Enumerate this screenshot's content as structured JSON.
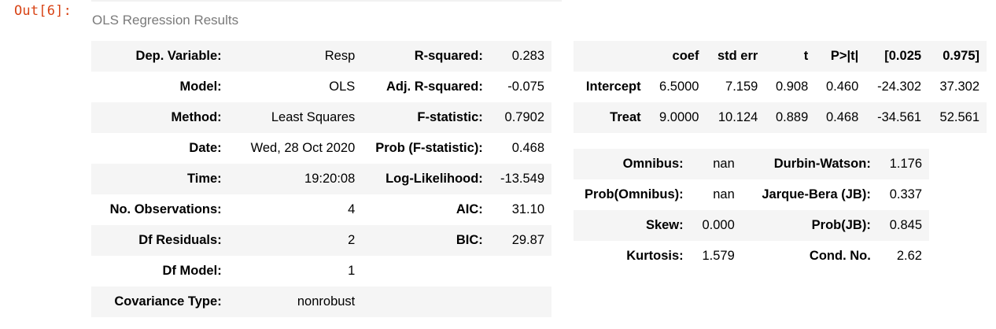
{
  "cell": {
    "prompt": "Out[6]:"
  },
  "summary": {
    "caption": "OLS Regression Results",
    "top_rows": [
      {
        "l1": "Dep. Variable:",
        "v1": "Resp",
        "l2": "R-squared:",
        "v2": "0.283"
      },
      {
        "l1": "Model:",
        "v1": "OLS",
        "l2": "Adj. R-squared:",
        "v2": "-0.075"
      },
      {
        "l1": "Method:",
        "v1": "Least Squares",
        "l2": "F-statistic:",
        "v2": "0.7902"
      },
      {
        "l1": "Date:",
        "v1": "Wed, 28 Oct 2020",
        "l2": "Prob (F-statistic):",
        "v2": "0.468"
      },
      {
        "l1": "Time:",
        "v1": "19:20:08",
        "l2": "Log-Likelihood:",
        "v2": "-13.549"
      },
      {
        "l1": "No. Observations:",
        "v1": "4",
        "l2": "AIC:",
        "v2": "31.10"
      },
      {
        "l1": "Df Residuals:",
        "v1": "2",
        "l2": "BIC:",
        "v2": "29.87"
      },
      {
        "l1": "Df Model:",
        "v1": "1",
        "l2": "",
        "v2": ""
      },
      {
        "l1": "Covariance Type:",
        "v1": "nonrobust",
        "l2": "",
        "v2": ""
      }
    ],
    "coef_table": {
      "headers": [
        "",
        "coef",
        "std err",
        "t",
        "P>|t|",
        "[0.025",
        "0.975]"
      ],
      "rows": [
        [
          "Intercept",
          "6.5000",
          "7.159",
          "0.908",
          "0.460",
          "-24.302",
          "37.302"
        ],
        [
          "Treat",
          "9.0000",
          "10.124",
          "0.889",
          "0.468",
          "-34.561",
          "52.561"
        ]
      ]
    },
    "diag_rows": [
      {
        "l1": "Omnibus:",
        "v1": "nan",
        "l2": "Durbin-Watson:",
        "v2": "1.176"
      },
      {
        "l1": "Prob(Omnibus):",
        "v1": "nan",
        "l2": "Jarque-Bera (JB):",
        "v2": "0.337"
      },
      {
        "l1": "Skew:",
        "v1": "0.000",
        "l2": "Prob(JB):",
        "v2": "0.845"
      },
      {
        "l1": "Kurtosis:",
        "v1": "1.579",
        "l2": "Cond. No.",
        "v2": "2.62"
      }
    ]
  }
}
